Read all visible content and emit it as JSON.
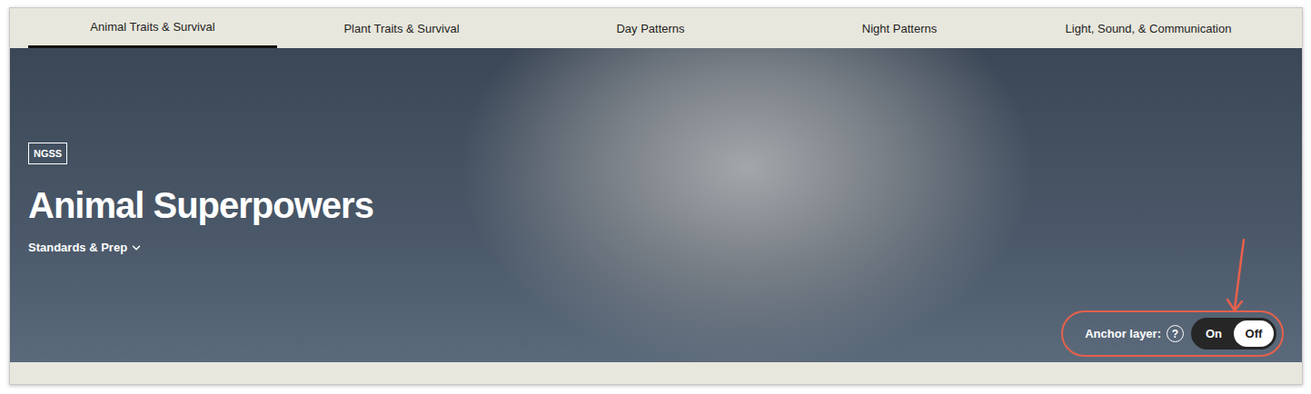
{
  "tabs": [
    {
      "label": "Animal Traits & Survival",
      "selected": true
    },
    {
      "label": "Plant Traits & Survival",
      "selected": false
    },
    {
      "label": "Day Patterns",
      "selected": false
    },
    {
      "label": "Night Patterns",
      "selected": false
    },
    {
      "label": "Light, Sound, & Communication",
      "selected": false
    }
  ],
  "hero": {
    "badge": "NGSS",
    "title": "Animal Superpowers",
    "standards_link": {
      "label": "Standards & Prep",
      "expanded": false
    }
  },
  "anchor_layer": {
    "label": "Anchor layer:",
    "help": "?",
    "options": [
      {
        "label": "On",
        "selected": false
      },
      {
        "label": "Off",
        "selected": true
      }
    ],
    "highlighted": true
  }
}
